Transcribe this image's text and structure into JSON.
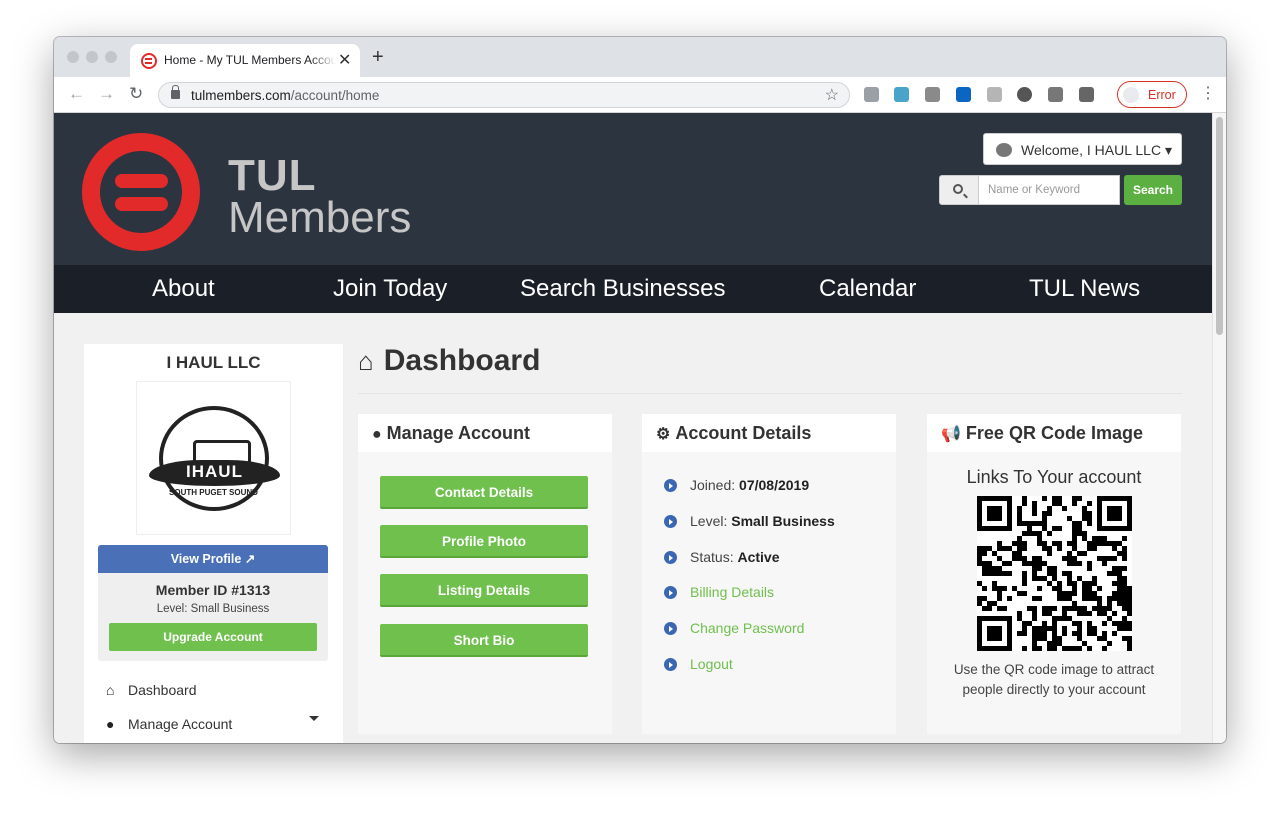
{
  "browser": {
    "tab_title": "Home - My TUL Members Account",
    "tab_close": "✕",
    "new_tab": "+",
    "url_host": "tulmembers.com",
    "url_path": "/account/home",
    "error_label": "Error",
    "back_icon": "arrow-left-icon",
    "forward_icon": "arrow-right-icon",
    "reload_icon": "reload-icon"
  },
  "site": {
    "brand_top": "TUL",
    "brand_bottom": "Members",
    "welcome": "Welcome, I HAUL LLC",
    "search_placeholder": "Name or Keyword",
    "search_button": "Search",
    "nav": [
      "About",
      "Join Today",
      "Search Businesses",
      "Calendar",
      "TUL News"
    ],
    "accent_green": "#6fc04d",
    "header_bg": "#2c3440",
    "brand_red": "#e32a2a"
  },
  "sidebar": {
    "business_name": "I HAUL LLC",
    "logo_text": "IHAUL",
    "logo_subtext": "SOUTH PUGET SOUND",
    "view_profile": "View Profile",
    "member_id": "Member ID #1313",
    "level": "Level: Small Business",
    "upgrade": "Upgrade Account",
    "links": [
      {
        "label": "Dashboard",
        "icon": "home-icon"
      },
      {
        "label": "Manage Account",
        "icon": "user-icon"
      }
    ]
  },
  "main": {
    "title": "Dashboard",
    "manage": {
      "title": "Manage Account",
      "buttons": [
        "Contact Details",
        "Profile Photo",
        "Listing Details",
        "Short Bio"
      ]
    },
    "details": {
      "title": "Account Details",
      "joined_label": "Joined:",
      "joined_value": "07/08/2019",
      "level_label": "Level:",
      "level_value": "Small Business",
      "status_label": "Status:",
      "status_value": "Active",
      "links": [
        "Billing Details",
        "Change Password",
        "Logout"
      ]
    },
    "qr": {
      "title": "Free QR Code Image",
      "subtitle": "Links To Your account",
      "caption": "Use the QR code image to attract people directly to your account"
    }
  }
}
